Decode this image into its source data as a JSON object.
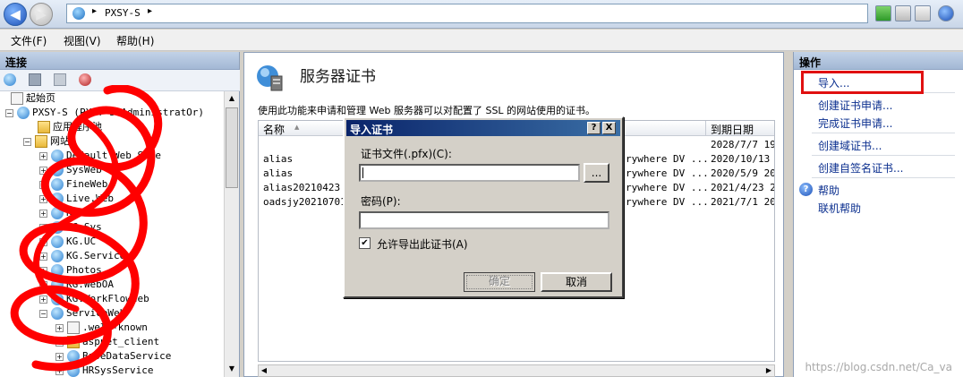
{
  "address": {
    "path": "PXSY-S",
    "sep": "▸"
  },
  "menu": [
    "文件(F)",
    "视图(V)",
    "帮助(H)"
  ],
  "left": {
    "header": "连接",
    "tree": [
      {
        "label": "起始页",
        "icon": "page"
      },
      {
        "label": "PXSY-S (PXSY-S\\AdministratOr)",
        "icon": "globe",
        "mono": true
      },
      {
        "label": "应用程序池",
        "icon": "folder"
      },
      {
        "label": "网站",
        "icon": "folder"
      },
      {
        "label": "Default Web Site",
        "icon": "globe"
      },
      {
        "label": "SysWeb",
        "icon": "globe"
      },
      {
        "label": "FineWeb",
        "icon": "globe"
      },
      {
        "label": "Live.Web",
        "icon": "globe"
      },
      {
        "label": "KG.Web",
        "icon": "globe"
      },
      {
        "label": "KG.Sys",
        "icon": "globe"
      },
      {
        "label": "KG.UC",
        "icon": "globe"
      },
      {
        "label": "KG.Service",
        "icon": "globe"
      },
      {
        "label": "Photos",
        "icon": "globe"
      },
      {
        "label": "KG.WebOA",
        "icon": "globe"
      },
      {
        "label": "KG.WorkFlowWeb",
        "icon": "globe"
      },
      {
        "label": "ServiceWeb",
        "icon": "globe"
      },
      {
        "label": ".well-known",
        "icon": "folder"
      },
      {
        "label": "aspnet_client",
        "icon": "folder"
      },
      {
        "label": "BaseDataService",
        "icon": "globe"
      },
      {
        "label": "HRSysService",
        "icon": "globe"
      }
    ]
  },
  "center": {
    "title": "服务器证书",
    "description": "使用此功能来申请和管理 Web 服务器可以对配置了 SSL 的网站使用的证书。",
    "columns": {
      "name": "名称",
      "expiry": "到期日期"
    },
    "rows": [
      {
        "name": "",
        "issuer": "",
        "expiry": "2028/7/7 19:"
      },
      {
        "name": "alias",
        "issuer": "rywhere DV ...",
        "expiry": "2020/10/13 2"
      },
      {
        "name": "alias",
        "issuer": "rywhere DV ...",
        "expiry": "2020/5/9 20:"
      },
      {
        "name": "alias20210423",
        "issuer": "rywhere DV ...",
        "expiry": "2021/4/23 20"
      },
      {
        "name": "oadsjy20210701",
        "issuer": "rywhere DV ...",
        "expiry": "2021/7/1 20:"
      }
    ]
  },
  "right": {
    "header": "操作",
    "actions": [
      "导入...",
      "创建证书申请...",
      "完成证书申请...",
      "创建域证书...",
      "创建自签名证书..."
    ],
    "help": "帮助",
    "online_help": "联机帮助"
  },
  "dialog": {
    "title": "导入证书",
    "help_btn": "?",
    "close_btn": "X",
    "file_label": "证书文件(.pfx)(C):",
    "file_value": "",
    "browse": "...",
    "password_label": "密码(P):",
    "password_value": "",
    "allow_export": "允许导出此证书(A)",
    "allow_export_checked": "✔",
    "ok": "确定",
    "cancel": "取消"
  },
  "watermark": "https://blog.csdn.net/Ca_va",
  "colors": {
    "highlight": "#e01010",
    "titlebar": "#0a246a",
    "scribble": "#ff0000"
  }
}
